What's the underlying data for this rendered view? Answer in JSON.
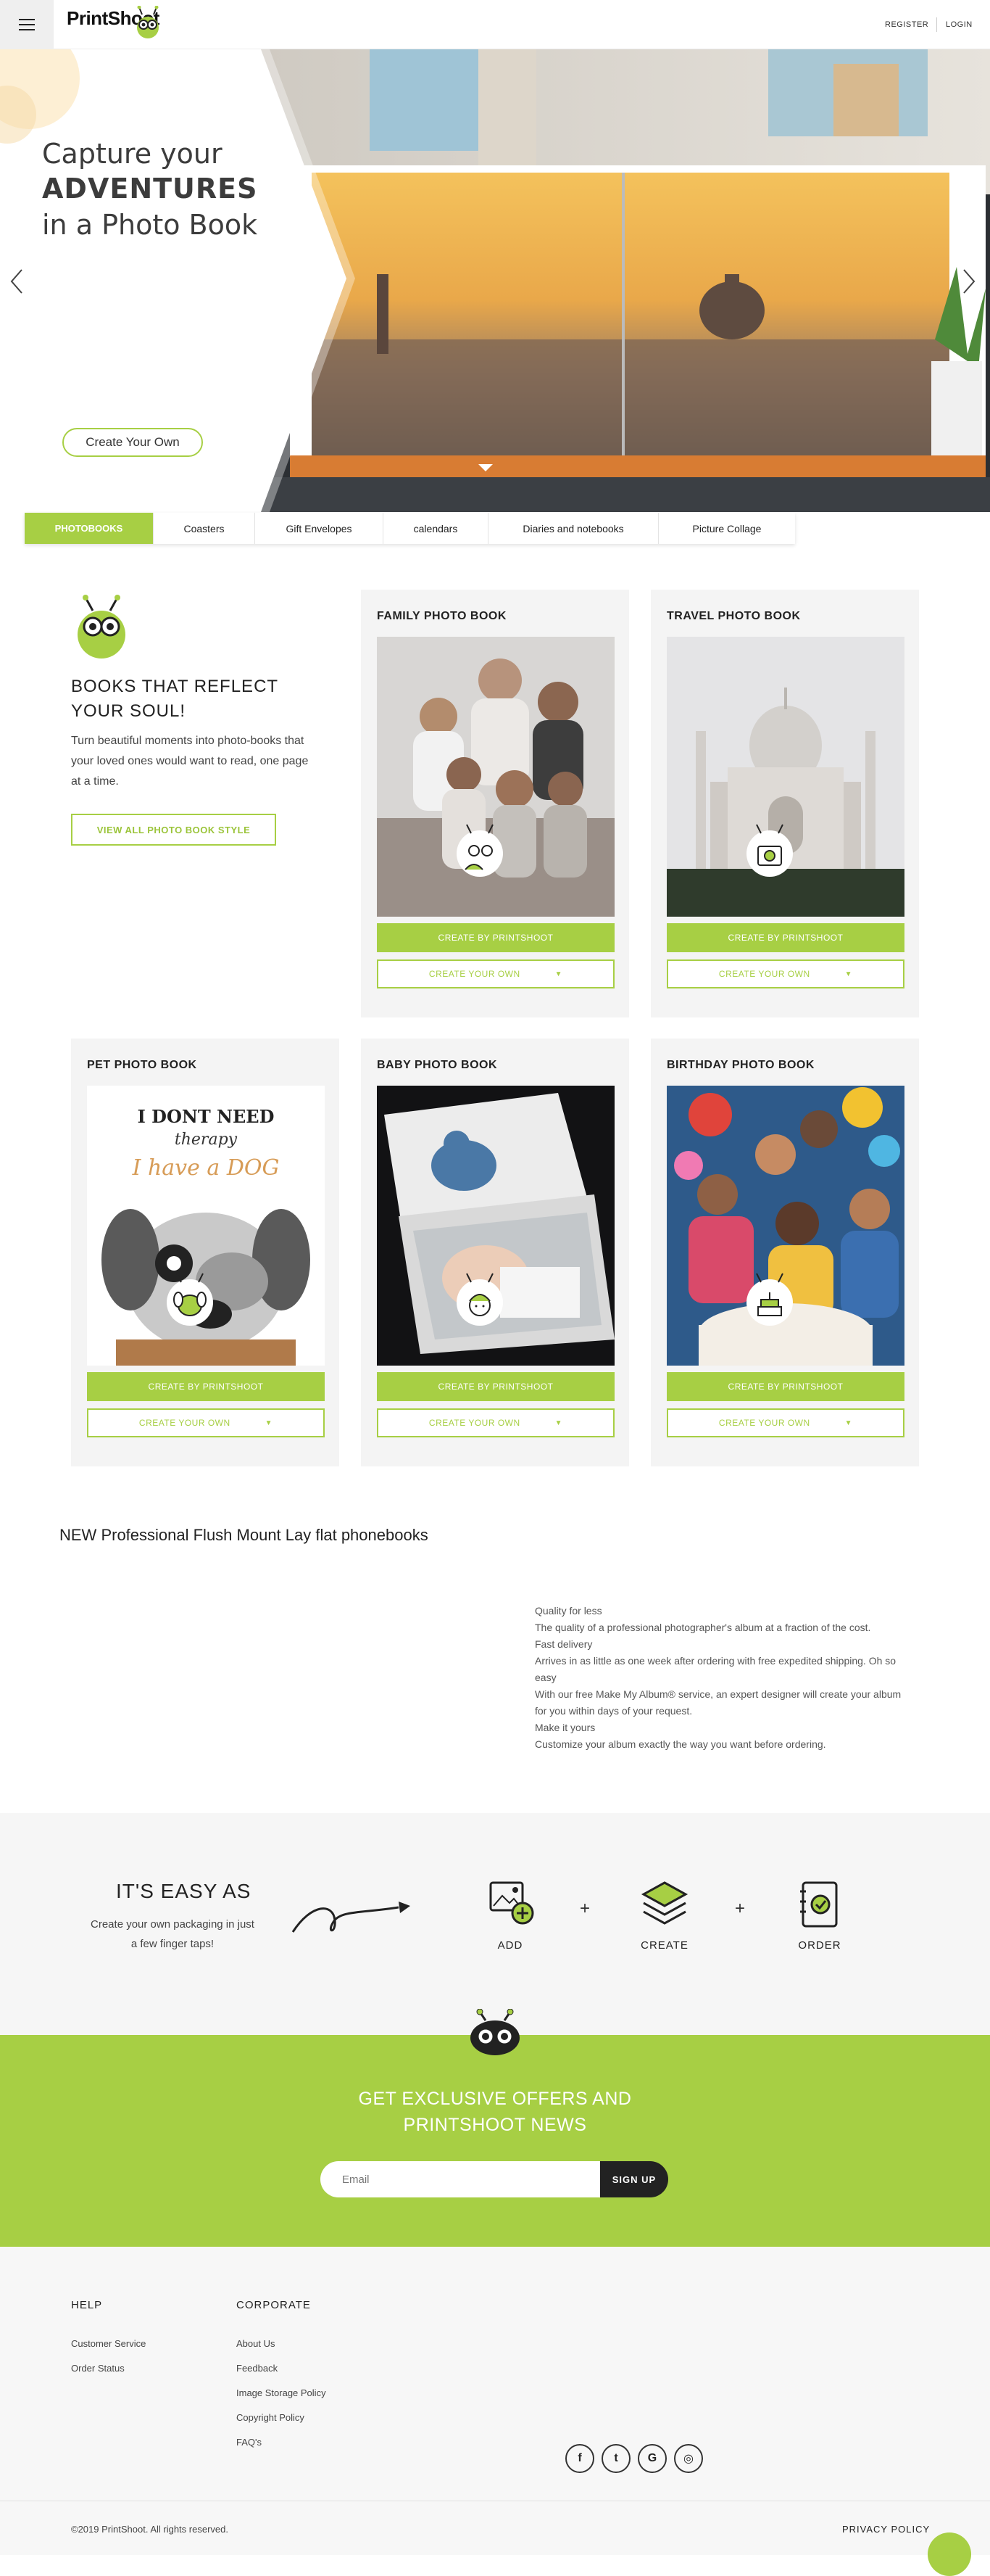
{
  "header": {
    "logo_text": "PrintShoot",
    "register_label": "REGISTER",
    "login_label": "LOGIN"
  },
  "hero": {
    "line1": "Capture your",
    "line2": "ADVENTURES",
    "line3": "in a Photo Book",
    "cta_label": "Create Your Own"
  },
  "tabs": [
    {
      "label": "PHOTOBOOKS",
      "active": true
    },
    {
      "label": "Coasters",
      "active": false
    },
    {
      "label": "Gift Envelopes",
      "active": false
    },
    {
      "label": "calendars",
      "active": false
    },
    {
      "label": "Diaries and notebooks",
      "active": false
    },
    {
      "label": "Picture Collage",
      "active": false
    }
  ],
  "intro": {
    "heading": "BOOKS THAT REFLECT YOUR SOUL!",
    "text": "Turn beautiful moments into photo-books that your loved ones would want to read, one page at a time.",
    "button_label": "VIEW ALL PHOTO BOOK STYLE"
  },
  "products": [
    {
      "title": "FAMILY PHOTO BOOK",
      "primary_label": "CREATE BY PRINTSHOOT",
      "secondary_label": "CREATE YOUR OWN"
    },
    {
      "title": "TRAVEL PHOTO BOOK",
      "primary_label": "CREATE BY PRINTSHOOT",
      "secondary_label": "CREATE YOUR OWN"
    },
    {
      "title": "PET PHOTO BOOK",
      "primary_label": "CREATE BY PRINTSHOOT",
      "secondary_label": "CREATE YOUR OWN",
      "image_text_1": "I DONT NEED",
      "image_text_2": "therapy",
      "image_text_3": "I have a DOG"
    },
    {
      "title": "BABY PHOTO BOOK",
      "primary_label": "CREATE BY PRINTSHOOT",
      "secondary_label": "CREATE YOUR OWN"
    },
    {
      "title": "BIRTHDAY PHOTO BOOK",
      "primary_label": "CREATE BY PRINTSHOOT",
      "secondary_label": "CREATE YOUR OWN"
    }
  ],
  "flush": {
    "title": "NEW Professional Flush Mount Lay flat phonebooks",
    "features": [
      "Quality for less",
      "The quality of a professional photographer's album at a fraction of the cost.",
      "Fast delivery",
      "Arrives in as little as one week after ordering with free expedited shipping. Oh so easy",
      "With our free Make My Album® service, an expert designer will create your album for you within days of your request.",
      "Make it yours",
      "Customize your album exactly the way you want before ordering."
    ]
  },
  "easy": {
    "title": "IT'S EASY AS",
    "subtitle": "Create your own packaging in just a few finger taps!",
    "steps": [
      {
        "label": "ADD",
        "icon": "add-photo-icon"
      },
      {
        "label": "CREATE",
        "icon": "layers-icon"
      },
      {
        "label": "ORDER",
        "icon": "order-checklist-icon"
      }
    ],
    "plus": "+"
  },
  "newsletter": {
    "title": "GET EXCLUSIVE OFFERS AND PRINTSHOOT NEWS",
    "email_placeholder": "Email",
    "signup_label": "SIGN UP"
  },
  "footer": {
    "help_heading": "HELP",
    "help_links": [
      "Customer Service",
      "Order Status"
    ],
    "corporate_heading": "CORPORATE",
    "corporate_links": [
      "About Us",
      "Feedback",
      "Image Storage Policy",
      "Copyright Policy",
      "FAQ's"
    ],
    "social": [
      {
        "icon": "facebook-icon",
        "glyph": "f"
      },
      {
        "icon": "twitter-icon",
        "glyph": "t"
      },
      {
        "icon": "google-icon",
        "glyph": "G"
      },
      {
        "icon": "instagram-icon",
        "glyph": "◎"
      }
    ],
    "copyright": "©2019 PrintShoot. All rights reserved.",
    "privacy_label": "PRIVACY POLICY"
  },
  "colors": {
    "brand_green": "#a7cf44",
    "dark": "#222222",
    "card_bg": "#f4f4f4"
  }
}
